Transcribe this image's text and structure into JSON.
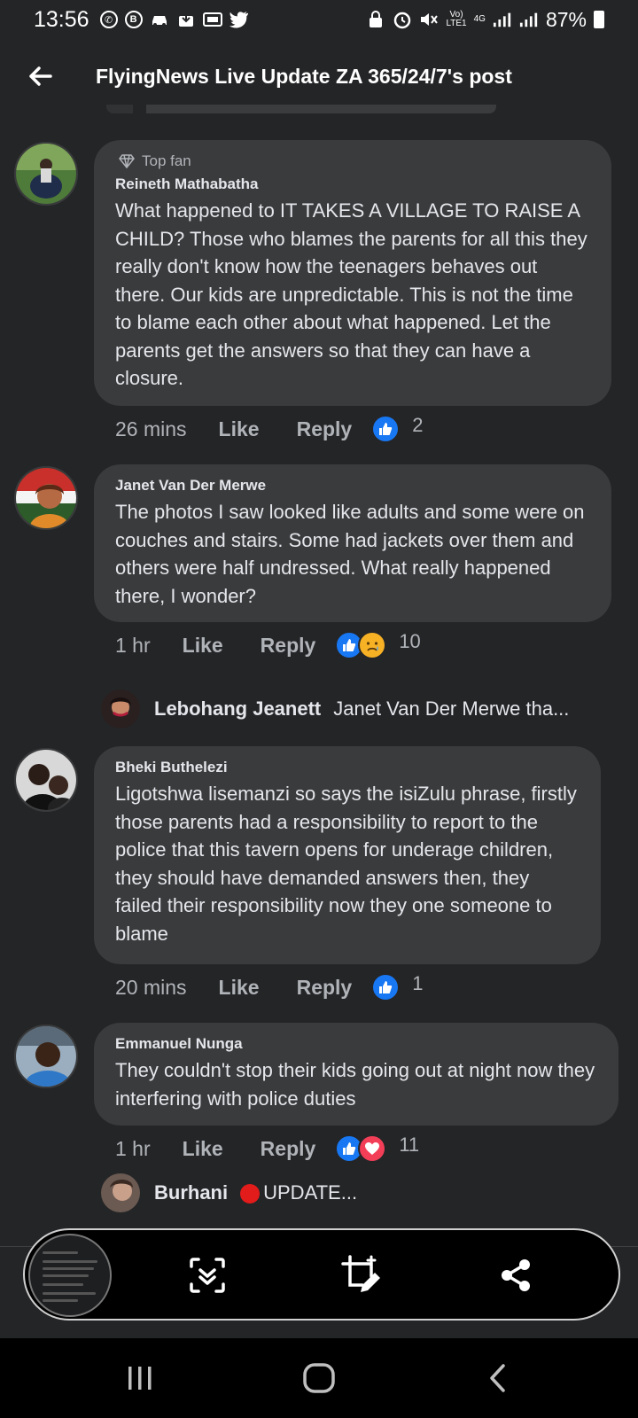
{
  "status_bar": {
    "time": "13:56",
    "signal_label_top": "Vo)",
    "signal_label_bottom": "LTE1",
    "network": "4G",
    "battery": "87%"
  },
  "header": {
    "title": "FlyingNews Live Update ZA 365/24/7's post"
  },
  "comments": [
    {
      "badge": "Top fan",
      "author": "Reineth Mathabatha",
      "text": "What happened to IT TAKES A VILLAGE TO RAISE A CHILD? Those who blames the parents for all this they really don't  know how the teenagers behaves out there. Our kids are unpredictable. This is not the time to blame each other about what happened. Let the parents get the answers so that they can have a closure.",
      "time": "26 mins",
      "like_label": "Like",
      "reply_label": "Reply",
      "reaction_count": "2",
      "reactions": [
        "like"
      ]
    },
    {
      "author": "Janet Van Der Merwe",
      "text": "The photos I saw looked like adults and some were on couches and stairs. Some had jackets over them and others were half undressed.  What really happened there, I wonder?",
      "time": "1 hr",
      "like_label": "Like",
      "reply_label": "Reply",
      "reaction_count": "10",
      "reactions": [
        "like",
        "sad"
      ]
    },
    {
      "author": "Bheki Buthelezi",
      "text": "Ligotshwa lisemanzi so says the isiZulu phrase, firstly those parents had a responsibility to report to the police that this tavern opens for underage children, they should have demanded answers then, they failed their responsibility now they one someone to blame",
      "time": "20 mins",
      "like_label": "Like",
      "reply_label": "Reply",
      "reaction_count": "1",
      "reactions": [
        "like"
      ]
    },
    {
      "author": "Emmanuel Nunga",
      "text": "They couldn't stop their kids going out at night now they interfering with police duties",
      "time": "1 hr",
      "like_label": "Like",
      "reply_label": "Reply",
      "reaction_count": "11",
      "reactions": [
        "like",
        "love"
      ]
    }
  ],
  "reply_previews": [
    {
      "name": "Lebohang Jeanett",
      "text": "Janet Van Der Merwe tha..."
    },
    {
      "name": "Burhani",
      "text": "UPDATE..."
    }
  ],
  "colors": {
    "background": "#242527",
    "bubble": "#3a3b3c",
    "like_blue": "#1877f2",
    "love_red": "#f33e58",
    "sad_yellow": "#f7b125"
  },
  "icons": {
    "toolbar": [
      "scroll-capture-icon",
      "crop-edit-icon",
      "share-icon"
    ],
    "nav": [
      "recents-icon",
      "home-icon",
      "back-icon"
    ]
  }
}
